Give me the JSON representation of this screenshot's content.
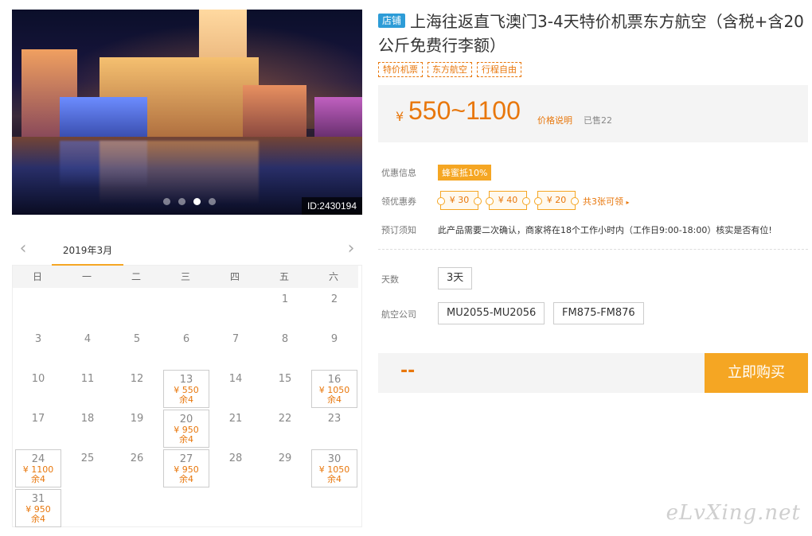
{
  "photo": {
    "id_text": "ID:2430194",
    "carousel": {
      "count": 4,
      "active": 3
    }
  },
  "calendar": {
    "month": "2019年3月",
    "weekdays": [
      "日",
      "一",
      "二",
      "三",
      "四",
      "五",
      "六"
    ],
    "leading_blanks": 5,
    "days": [
      {
        "d": "1"
      },
      {
        "d": "2"
      },
      {
        "d": "3"
      },
      {
        "d": "4"
      },
      {
        "d": "5"
      },
      {
        "d": "6"
      },
      {
        "d": "7"
      },
      {
        "d": "8"
      },
      {
        "d": "9"
      },
      {
        "d": "10"
      },
      {
        "d": "11"
      },
      {
        "d": "12"
      },
      {
        "d": "13",
        "price": "¥ 550",
        "stock": "余4"
      },
      {
        "d": "14"
      },
      {
        "d": "15"
      },
      {
        "d": "16",
        "price": "¥ 1050",
        "stock": "余4"
      },
      {
        "d": "17"
      },
      {
        "d": "18"
      },
      {
        "d": "19"
      },
      {
        "d": "20",
        "price": "¥ 950",
        "stock": "余4"
      },
      {
        "d": "21"
      },
      {
        "d": "22"
      },
      {
        "d": "23"
      },
      {
        "d": "24",
        "price": "¥ 1100",
        "stock": "余4"
      },
      {
        "d": "25"
      },
      {
        "d": "26"
      },
      {
        "d": "27",
        "price": "¥ 950",
        "stock": "余4"
      },
      {
        "d": "28"
      },
      {
        "d": "29"
      },
      {
        "d": "30",
        "price": "¥ 1050",
        "stock": "余4"
      },
      {
        "d": "31",
        "price": "¥ 950",
        "stock": "余4"
      }
    ]
  },
  "product": {
    "shop_tag": "店铺",
    "title": "上海往返直飞澳门3-4天特价机票东方航空（含税+含20公斤免费行李额）",
    "tags": [
      "特价机票",
      "东方航空",
      "行程自由"
    ],
    "currency": "¥",
    "price_range": "550~1100",
    "price_note": "价格说明",
    "sold": "已售22"
  },
  "info": {
    "discount_label": "优惠信息",
    "discount_badge": "蜂蜜抵10%",
    "coupon_label": "领优惠券",
    "coupons": [
      "¥ 30",
      "¥ 40",
      "¥ 20"
    ],
    "coupon_more": "共3张可领",
    "notice_label": "预订须知",
    "notice_text": "此产品需要二次确认，商家将在18个工作小时内（工作日9:00-18:00）核实是否有位!"
  },
  "options": {
    "days_label": "天数",
    "days_value": "3天",
    "airline_label": "航空公司",
    "flights": [
      "MU2055-MU2056",
      "FM875-FM876"
    ]
  },
  "buy": {
    "total": "--",
    "button": "立即购买"
  },
  "watermark": "eLvXing.net",
  "colors": {
    "accent": "#f5a623",
    "price": "#e8770c",
    "shop_tag": "#2d9cd7"
  }
}
